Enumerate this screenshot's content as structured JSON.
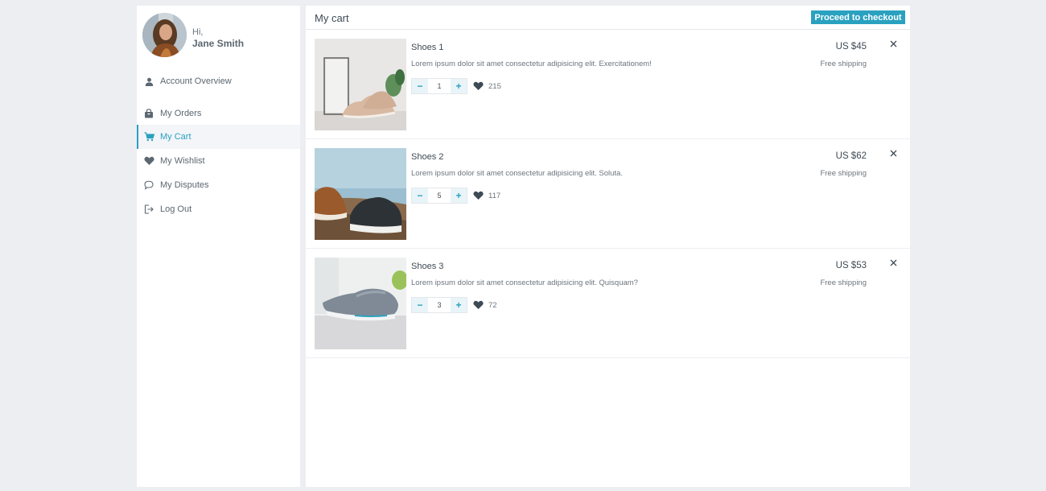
{
  "profile": {
    "greeting": "Hi,",
    "name": "Jane Smith"
  },
  "sidebar": {
    "items": [
      {
        "label": "Account Overview",
        "icon": "user-icon"
      },
      {
        "label": "My Orders",
        "icon": "bag-icon"
      },
      {
        "label": "My Cart",
        "icon": "cart-icon",
        "active": true
      },
      {
        "label": "My Wishlist",
        "icon": "heart-icon"
      },
      {
        "label": "My Disputes",
        "icon": "chat-bubble-icon"
      },
      {
        "label": "Log Out",
        "icon": "logout-icon"
      }
    ]
  },
  "main": {
    "title": "My cart",
    "checkout_label": "Proceed to checkout"
  },
  "cart": {
    "items": [
      {
        "name": "Shoes 1",
        "description": "Lorem ipsum dolor sit amet consectetur adipisicing elit. Exercitationem!",
        "quantity": "1",
        "likes": "215",
        "price": "US $45",
        "shipping": "Free shipping"
      },
      {
        "name": "Shoes 2",
        "description": "Lorem ipsum dolor sit amet consectetur adipisicing elit. Soluta.",
        "quantity": "5",
        "likes": "117",
        "price": "US $62",
        "shipping": "Free shipping"
      },
      {
        "name": "Shoes 3",
        "description": "Lorem ipsum dolor sit amet consectetur adipisicing elit. Quisquam?",
        "quantity": "3",
        "likes": "72",
        "price": "US $53",
        "shipping": "Free shipping"
      }
    ]
  },
  "colors": {
    "accent": "#2aa1c0",
    "background": "#edeef2",
    "icon_gray": "#5b6770"
  }
}
